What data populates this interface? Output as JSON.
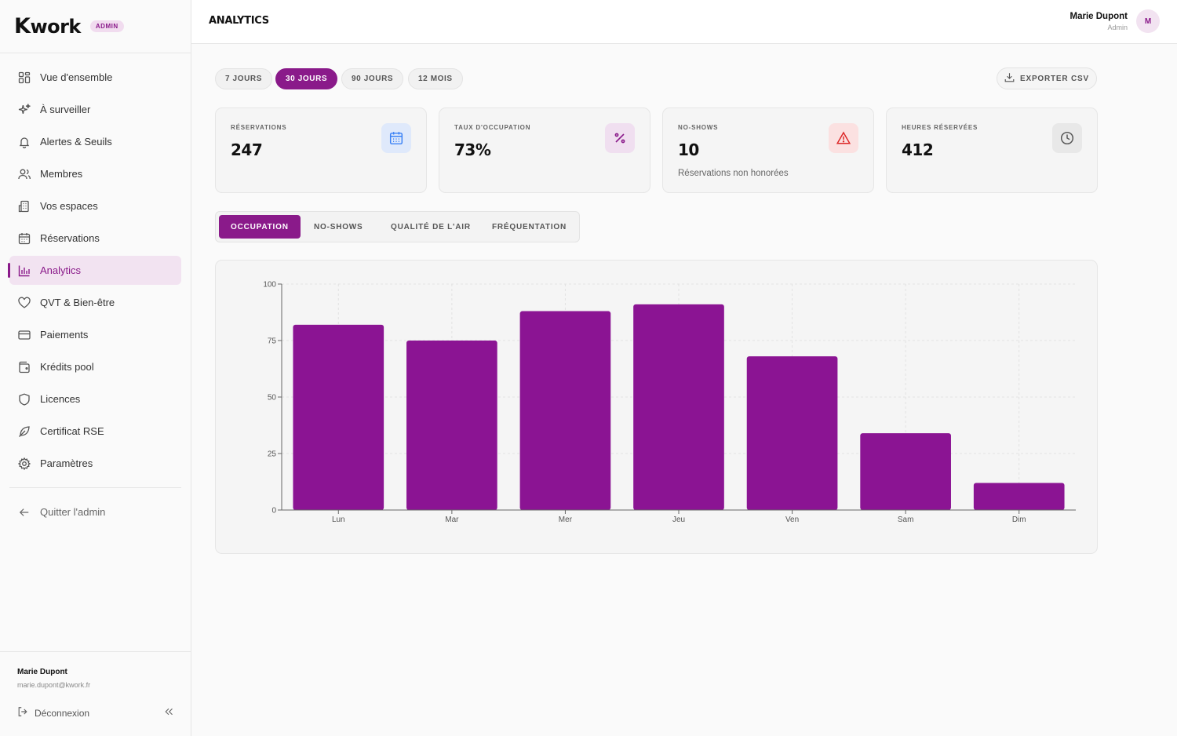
{
  "brand": {
    "name": "work",
    "initial": "K",
    "badge": "ADMIN"
  },
  "sidebar": {
    "items": [
      {
        "label": "Vue d'ensemble",
        "icon": "grid-icon"
      },
      {
        "label": "À surveiller",
        "icon": "sparkles-icon"
      },
      {
        "label": "Alertes & Seuils",
        "icon": "bell-icon"
      },
      {
        "label": "Membres",
        "icon": "users-icon"
      },
      {
        "label": "Vos espaces",
        "icon": "building-icon"
      },
      {
        "label": "Réservations",
        "icon": "calendar-icon"
      },
      {
        "label": "Analytics",
        "icon": "bar-chart-icon",
        "active": true
      },
      {
        "label": "QVT & Bien-être",
        "icon": "heart-icon"
      },
      {
        "label": "Paiements",
        "icon": "credit-card-icon"
      },
      {
        "label": "Krédits pool",
        "icon": "wallet-icon"
      },
      {
        "label": "Licences",
        "icon": "shield-icon"
      },
      {
        "label": "Certificat RSE",
        "icon": "leaf-icon"
      },
      {
        "label": "Paramètres",
        "icon": "gear-icon"
      }
    ],
    "exit_label": "Quitter l'admin",
    "footer": {
      "name": "Marie Dupont",
      "email": "marie.dupont@kwork.fr",
      "logout_label": "Déconnexion"
    }
  },
  "header": {
    "title": "ANALYTICS",
    "user_name": "Marie Dupont",
    "user_role": "Admin",
    "avatar_initial": "M"
  },
  "periods": [
    {
      "label": "7 JOURS",
      "active": false
    },
    {
      "label": "30 JOURS",
      "active": true
    },
    {
      "label": "90 JOURS",
      "active": false
    },
    {
      "label": "12 MOIS",
      "active": false
    }
  ],
  "export_label": "EXPORTER CSV",
  "kpis": [
    {
      "label": "RÉSERVATIONS",
      "value": "247",
      "sub": "",
      "icon": "calendar-icon",
      "color": "#3b82f6"
    },
    {
      "label": "TAUX D'OCCUPATION",
      "value": "73%",
      "sub": "",
      "icon": "percent-icon",
      "color": "#8a1a8a"
    },
    {
      "label": "NO-SHOWS",
      "value": "10",
      "sub": "Réservations non honorées",
      "icon": "alert-triangle-icon",
      "color": "#dc2626"
    },
    {
      "label": "HEURES RÉSERVÉES",
      "value": "412",
      "sub": "",
      "icon": "clock-icon",
      "color": "#555555"
    }
  ],
  "tabs": [
    {
      "label": "OCCUPATION",
      "active": true
    },
    {
      "label": "NO-SHOWS",
      "active": false
    },
    {
      "label": "QUALITÉ DE L'AIR",
      "active": false
    },
    {
      "label": "FRÉQUENTATION",
      "active": false
    }
  ],
  "colors": {
    "accent": "#8a1a8a",
    "bar": "#8b1493"
  },
  "chart_data": {
    "type": "bar",
    "categories": [
      "Lun",
      "Mar",
      "Mer",
      "Jeu",
      "Ven",
      "Sam",
      "Dim"
    ],
    "values": [
      82,
      75,
      88,
      91,
      68,
      34,
      12
    ],
    "yticks": [
      0,
      25,
      50,
      75,
      100
    ],
    "ylim": [
      0,
      100
    ],
    "title": "",
    "xlabel": "",
    "ylabel": "",
    "grid": true
  }
}
